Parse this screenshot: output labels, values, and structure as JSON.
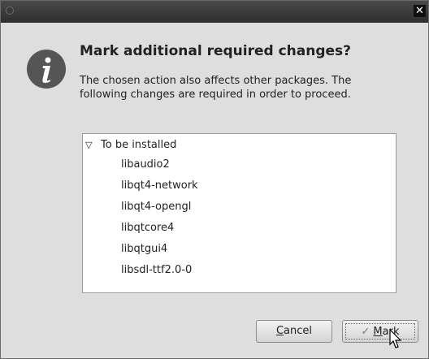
{
  "dialog": {
    "title": "Mark additional required changes?",
    "description": "The chosen action also affects other packages. The following changes are required in order to proceed.",
    "close_glyph": "✕"
  },
  "changes": {
    "group_label": "To be installed",
    "expand_glyph": "▽",
    "packages": [
      "libaudio2",
      "libqt4-network",
      "libqt4-opengl",
      "libqtcore4",
      "libqtgui4",
      "libsdl-ttf2.0-0"
    ]
  },
  "buttons": {
    "cancel_mnemonic": "C",
    "cancel_rest": "ancel",
    "mark_mnemonic": "M",
    "mark_rest": "ark",
    "mark_glyph": "✓"
  },
  "colors": {
    "icon": "#555555",
    "titlebar": "#3a3a3a"
  }
}
